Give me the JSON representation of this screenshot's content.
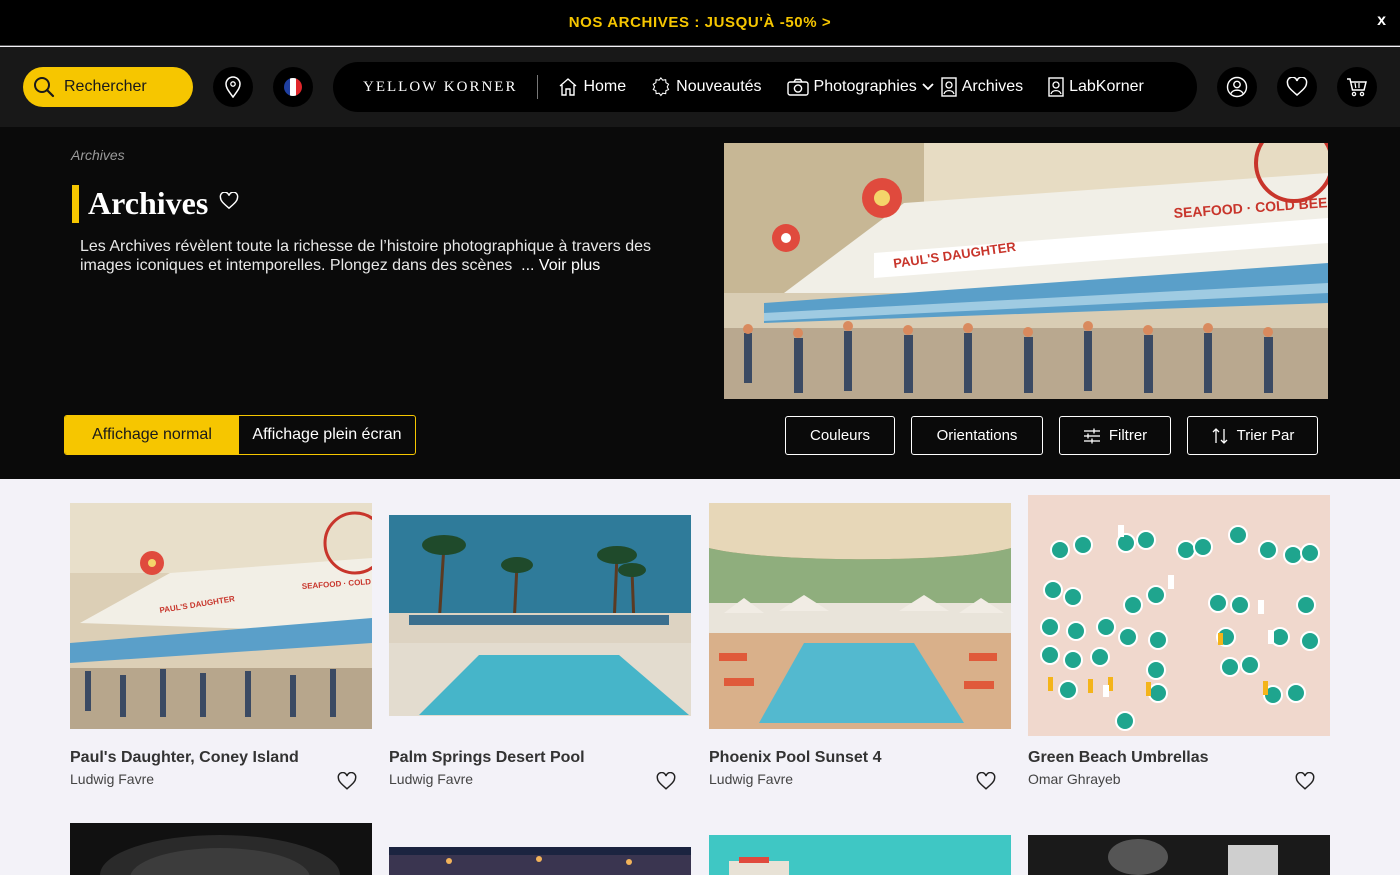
{
  "promo": {
    "text": "NOS ARCHIVES : JUSQU'À -50% >",
    "close": "x"
  },
  "header": {
    "search_label": "Rechercher",
    "logo": "YELLOW KORNER",
    "nav": [
      {
        "label": "Home",
        "icon": "home-icon"
      },
      {
        "label": "Nouveautés",
        "icon": "new-badge-icon"
      },
      {
        "label": "Photographies",
        "icon": "camera-icon"
      },
      {
        "label": "Archives",
        "icon": "portrait-icon"
      },
      {
        "label": "LabKorner",
        "icon": "portrait-icon"
      }
    ]
  },
  "hero": {
    "breadcrumb": "Archives",
    "title": "Archives",
    "description": "Les Archives révèlent toute la richesse de l’histoire photographique à travers des images iconiques et intemporelles. Plongez dans des scènes",
    "more": "... Voir plus",
    "view_normal": "Affichage normal",
    "view_fullscreen": "Affichage plein écran",
    "filters": {
      "colors": "Couleurs",
      "orientations": "Orientations",
      "filter": "Filtrer",
      "sort": "Trier Par"
    }
  },
  "products": [
    {
      "title": "Paul's Daughter, Coney Island",
      "artist": "Ludwig Favre"
    },
    {
      "title": "Palm Springs Desert Pool",
      "artist": "Ludwig Favre"
    },
    {
      "title": "Phoenix Pool Sunset 4",
      "artist": "Ludwig Favre"
    },
    {
      "title": "Green Beach Umbrellas",
      "artist": "Omar Ghrayeb"
    }
  ],
  "colors": {
    "accent": "#f6c600",
    "dark": "#0a0a0a"
  }
}
